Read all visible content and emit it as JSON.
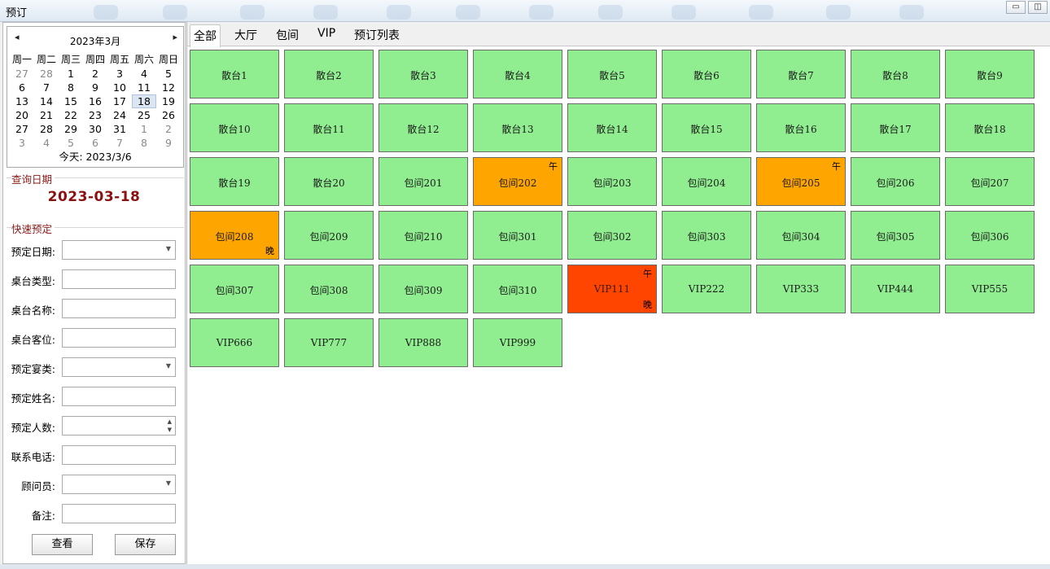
{
  "window": {
    "title": "预订",
    "minimize_icon": "minimize-icon",
    "restore_icon": "restore-icon"
  },
  "calendar": {
    "month_title": "2023年3月",
    "prev_icon": "◂",
    "next_icon": "▸",
    "weekdays": [
      "周一",
      "周二",
      "周三",
      "周四",
      "周五",
      "周六",
      "周日"
    ],
    "weeks": [
      [
        "27",
        "28",
        "1",
        "2",
        "3",
        "4",
        "5"
      ],
      [
        "6",
        "7",
        "8",
        "9",
        "10",
        "11",
        "12"
      ],
      [
        "13",
        "14",
        "15",
        "16",
        "17",
        "18",
        "19"
      ],
      [
        "20",
        "21",
        "22",
        "23",
        "24",
        "25",
        "26"
      ],
      [
        "27",
        "28",
        "29",
        "30",
        "31",
        "1",
        "2"
      ],
      [
        "3",
        "4",
        "5",
        "6",
        "7",
        "8",
        "9"
      ]
    ],
    "muted_cells": [
      [
        0,
        0
      ],
      [
        0,
        1
      ],
      [
        4,
        5
      ],
      [
        4,
        6
      ],
      [
        5,
        0
      ],
      [
        5,
        1
      ],
      [
        5,
        2
      ],
      [
        5,
        3
      ],
      [
        5,
        4
      ],
      [
        5,
        5
      ],
      [
        5,
        6
      ]
    ],
    "selected_cell": [
      2,
      5
    ],
    "today_text": "今天: 2023/3/6"
  },
  "query": {
    "section_title": "查询日期",
    "date": "2023-03-18"
  },
  "quick_booking": {
    "section_title": "快速预定",
    "fields": [
      {
        "label": "预定日期:",
        "type": "dropdown",
        "value": ""
      },
      {
        "label": "桌台类型:",
        "type": "text",
        "value": ""
      },
      {
        "label": "桌台名称:",
        "type": "text",
        "value": ""
      },
      {
        "label": "桌台客位:",
        "type": "text",
        "value": ""
      },
      {
        "label": "预定宴类:",
        "type": "dropdown",
        "value": ""
      },
      {
        "label": "预定姓名:",
        "type": "text",
        "value": ""
      },
      {
        "label": "预定人数:",
        "type": "spinner",
        "value": ""
      },
      {
        "label": "联系电话:",
        "type": "text",
        "value": ""
      },
      {
        "label": "顾问员:",
        "type": "dropdown",
        "value": ""
      },
      {
        "label": "备注:",
        "type": "text",
        "value": ""
      }
    ],
    "view_button": "查看",
    "save_button": "保存"
  },
  "tabs": [
    "全部",
    "大厅",
    "包间",
    "VIP",
    "预订列表"
  ],
  "active_tab": 0,
  "markers": {
    "noon": "午",
    "evening": "晚"
  },
  "status_colors": {
    "free": "#90ee90",
    "partial": "#ffa500",
    "full": "#ff4500"
  },
  "tables": [
    {
      "name": "散台1",
      "status": "free",
      "noon": false,
      "evening": false
    },
    {
      "name": "散台2",
      "status": "free",
      "noon": false,
      "evening": false
    },
    {
      "name": "散台3",
      "status": "free",
      "noon": false,
      "evening": false
    },
    {
      "name": "散台4",
      "status": "free",
      "noon": false,
      "evening": false
    },
    {
      "name": "散台5",
      "status": "free",
      "noon": false,
      "evening": false
    },
    {
      "name": "散台6",
      "status": "free",
      "noon": false,
      "evening": false
    },
    {
      "name": "散台7",
      "status": "free",
      "noon": false,
      "evening": false
    },
    {
      "name": "散台8",
      "status": "free",
      "noon": false,
      "evening": false
    },
    {
      "name": "散台9",
      "status": "free",
      "noon": false,
      "evening": false
    },
    {
      "name": "散台10",
      "status": "free",
      "noon": false,
      "evening": false
    },
    {
      "name": "散台11",
      "status": "free",
      "noon": false,
      "evening": false
    },
    {
      "name": "散台12",
      "status": "free",
      "noon": false,
      "evening": false
    },
    {
      "name": "散台13",
      "status": "free",
      "noon": false,
      "evening": false
    },
    {
      "name": "散台14",
      "status": "free",
      "noon": false,
      "evening": false
    },
    {
      "name": "散台15",
      "status": "free",
      "noon": false,
      "evening": false
    },
    {
      "name": "散台16",
      "status": "free",
      "noon": false,
      "evening": false
    },
    {
      "name": "散台17",
      "status": "free",
      "noon": false,
      "evening": false
    },
    {
      "name": "散台18",
      "status": "free",
      "noon": false,
      "evening": false
    },
    {
      "name": "散台19",
      "status": "free",
      "noon": false,
      "evening": false
    },
    {
      "name": "散台20",
      "status": "free",
      "noon": false,
      "evening": false
    },
    {
      "name": "包间201",
      "status": "free",
      "noon": false,
      "evening": false
    },
    {
      "name": "包间202",
      "status": "partial",
      "noon": true,
      "evening": false
    },
    {
      "name": "包间203",
      "status": "free",
      "noon": false,
      "evening": false
    },
    {
      "name": "包间204",
      "status": "free",
      "noon": false,
      "evening": false
    },
    {
      "name": "包间205",
      "status": "partial",
      "noon": true,
      "evening": false
    },
    {
      "name": "包间206",
      "status": "free",
      "noon": false,
      "evening": false
    },
    {
      "name": "包间207",
      "status": "free",
      "noon": false,
      "evening": false
    },
    {
      "name": "包间208",
      "status": "partial",
      "noon": false,
      "evening": true
    },
    {
      "name": "包间209",
      "status": "free",
      "noon": false,
      "evening": false
    },
    {
      "name": "包间210",
      "status": "free",
      "noon": false,
      "evening": false
    },
    {
      "name": "包间301",
      "status": "free",
      "noon": false,
      "evening": false
    },
    {
      "name": "包间302",
      "status": "free",
      "noon": false,
      "evening": false
    },
    {
      "name": "包间303",
      "status": "free",
      "noon": false,
      "evening": false
    },
    {
      "name": "包间304",
      "status": "free",
      "noon": false,
      "evening": false
    },
    {
      "name": "包间305",
      "status": "free",
      "noon": false,
      "evening": false
    },
    {
      "name": "包间306",
      "status": "free",
      "noon": false,
      "evening": false
    },
    {
      "name": "包间307",
      "status": "free",
      "noon": false,
      "evening": false
    },
    {
      "name": "包间308",
      "status": "free",
      "noon": false,
      "evening": false
    },
    {
      "name": "包间309",
      "status": "free",
      "noon": false,
      "evening": false
    },
    {
      "name": "包间310",
      "status": "free",
      "noon": false,
      "evening": false
    },
    {
      "name": "VIP111",
      "status": "full",
      "noon": true,
      "evening": true
    },
    {
      "name": "VIP222",
      "status": "free",
      "noon": false,
      "evening": false
    },
    {
      "name": "VIP333",
      "status": "free",
      "noon": false,
      "evening": false
    },
    {
      "name": "VIP444",
      "status": "free",
      "noon": false,
      "evening": false
    },
    {
      "name": "VIP555",
      "status": "free",
      "noon": false,
      "evening": false
    },
    {
      "name": "VIP666",
      "status": "free",
      "noon": false,
      "evening": false
    },
    {
      "name": "VIP777",
      "status": "free",
      "noon": false,
      "evening": false
    },
    {
      "name": "VIP888",
      "status": "free",
      "noon": false,
      "evening": false
    },
    {
      "name": "VIP999",
      "status": "free",
      "noon": false,
      "evening": false
    }
  ]
}
